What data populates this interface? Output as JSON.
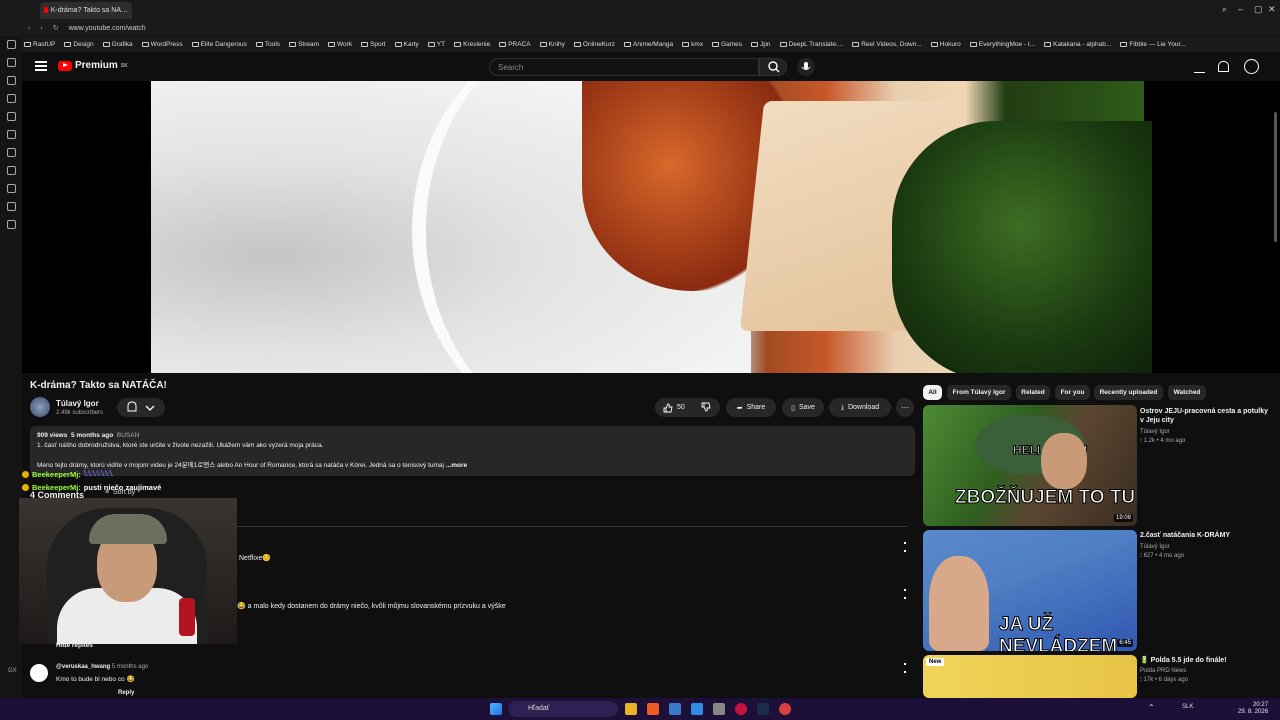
{
  "browser": {
    "tab_title": "K-dráma? Takto sa NA…",
    "url": "www.youtube.com/watch",
    "bookmarks": [
      "RastUP",
      "Design",
      "Grafika",
      "WordPress",
      "Elite Dangerous",
      "Tools",
      "Stream",
      "Work",
      "Sport",
      "Karty",
      "YT",
      "Kreslenie",
      "PRACA",
      "Knihy",
      "OnlineKurz",
      "Anime/Manga",
      "kmx",
      "Games",
      "Jpn",
      "DeepL Translate:...",
      "Reel Videos, Down...",
      "Hokuro",
      "EverythingMoe - I...",
      "Katakana - alphab...",
      "Fibble — Lie Your..."
    ]
  },
  "header": {
    "logo_text": "Premium",
    "logo_sup": "SK",
    "search_placeholder": "Search"
  },
  "video": {
    "title": "K-dráma? Takto sa NATÁČA!",
    "channel": "Túlavý Igor",
    "subscribers": "2.49k subscribers",
    "likes": "50",
    "share_label": "Share",
    "save_label": "Save",
    "download_label": "Download",
    "views": "909 views",
    "posted": "5 months ago",
    "location": "BUSAN",
    "desc_line1": "1. časť nášho dobrodružstva, ktoré ste určite v živote nezažili. Ukážem vám ako vyzerá moja práca.",
    "desc_line2": "Meno tejto drámy, ktorú vidíte v mojom videu je 24분에1로맨스 alebo An Hour of Romance, ktorá sa natáča v Kórei. Jedná sa o tenisový tumaj",
    "more": "...more"
  },
  "chat": [
    {
      "user": "BeekeeperMj:",
      "text": "𓆩𓆩𓆩𓆩𓆩𓆩𓆩"
    },
    {
      "user": "BeekeeperMj:",
      "text": "pusti niečo zaujímavé"
    }
  ],
  "comments": {
    "count_label": "4 Comments",
    "sort_label": "Sort by",
    "c1_fragment": "Netflixe😊",
    "c2_fragment": "😂 a malo kedy dostanem do drámy niečo, kvôli môjmu slovanskému prízvuku a výške",
    "hide_replies": "Hide replies",
    "c3_user": "@veruskaa_hwang",
    "c3_time": "5 months ago",
    "c3_text": "Kmo to bude bl nebo co 😂",
    "c3_reply": "Reply"
  },
  "filters": [
    "All",
    "From Túlavý Igor",
    "Related",
    "For you",
    "Recently uploaded",
    "Watched"
  ],
  "related": [
    {
      "thumb_text": "ZBOŽŇUJEM TO TU",
      "thumb_sub": "HELLO JEJU",
      "duration": "19:08",
      "title": "Ostrov JEJU-pracovná cesta a potulky v Jeju city",
      "channel": "Túlavý Igor",
      "meta": "1.2k • 4 mo ago"
    },
    {
      "thumb_text": "JA UŽ NEVLÁDZEM",
      "duration": "6:45",
      "title": "2.časť natáčania K-DRÁMY",
      "channel": "Túlavý Igor",
      "meta": "627 • 4 mo ago"
    },
    {
      "badge": "New",
      "title": "Polda 5.5 jde do finále!",
      "channel": "Polda PRD News",
      "meta": "17k • 6 days ago"
    }
  ],
  "taskbar": {
    "search": "Hľadať",
    "lang": "SLK",
    "time": "20:27",
    "date": "29. 8. 2026"
  },
  "colors": {
    "bg": "#0f0f0f",
    "chip": "#272727",
    "accent_red": "#ff0000",
    "chat_name": "#9cff3c",
    "taskbar": "#1c0f38"
  }
}
